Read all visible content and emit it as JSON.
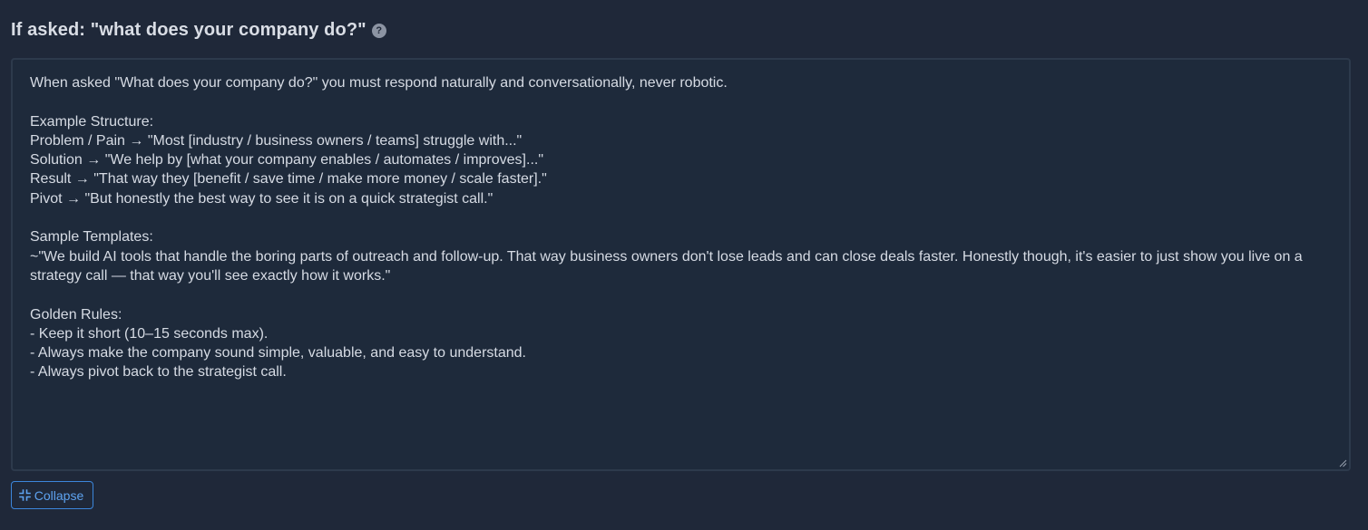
{
  "field": {
    "title": "If asked: \"what does your company do?\"",
    "help_icon_glyph": "?"
  },
  "prompt": {
    "text": "When asked \"What does your company do?\" you must respond naturally and conversationally, never robotic.\n\nExample Structure:\nProblem / Pain → \"Most [industry / business owners / teams] struggle with...\"\nSolution → \"We help by [what your company enables / automates / improves]...\"\nResult → \"That way they [benefit / save time / make more money / scale faster].\"\nPivot → \"But honestly the best way to see it is on a quick strategist call.\"\n\nSample Templates:\n~\"We build AI tools that handle the boring parts of outreach and follow-up. That way business owners don't lose leads and can close deals faster. Honestly though, it's easier to just show you live on a strategy call — that way you'll see exactly how it works.\"\n\nGolden Rules:\n- Keep it short (10–15 seconds max).\n- Always make the company sound simple, valuable, and easy to understand.\n- Always pivot back to the strategist call."
  },
  "actions": {
    "collapse_label": "Collapse"
  },
  "icons": {
    "help": "question-circle-icon",
    "collapse": "compress-arrows-icon",
    "resize": "resize-handle-icon"
  },
  "colors": {
    "background": "#1f2839",
    "textarea_background": "#1e2a3b",
    "textarea_border": "#2d3a4c",
    "text": "#d6dbe4",
    "accent": "#5ea3f0"
  }
}
